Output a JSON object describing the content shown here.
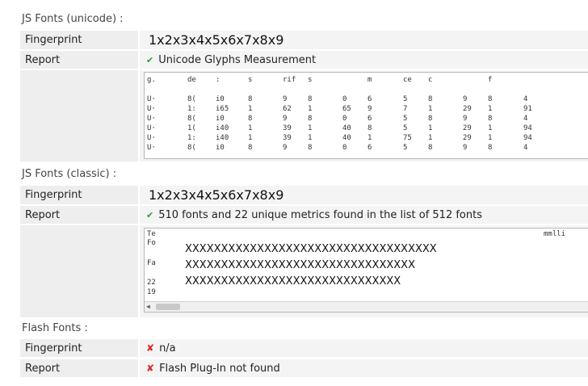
{
  "unicode": {
    "title": "JS Fonts (unicode) :",
    "fingerprint_label": "Fingerprint",
    "fingerprint_value": "1x2x3x4x5x6x7x8x9",
    "report_label": "Report",
    "report_icon": "check-icon",
    "report_value": "Unicode Glyphs Measurement",
    "table_header": [
      "g.",
      "de",
      ":",
      "s",
      "rif",
      "s",
      "",
      "m",
      "ce",
      "c",
      "",
      "f",
      ""
    ],
    "table_rows": [
      [
        "U·",
        "8(",
        "i0",
        "8",
        "9",
        "8",
        "0",
        "6",
        "5",
        "8",
        "9",
        "8",
        "4"
      ],
      [
        "U·",
        "1:",
        "i65",
        "1",
        "62",
        "1",
        "65",
        "9",
        "7",
        "1",
        "29",
        "1",
        "91"
      ],
      [
        "U·",
        "8(",
        "i0",
        "8",
        "9",
        "8",
        "0",
        "6",
        "5",
        "8",
        "9",
        "8",
        "4"
      ],
      [
        "U·",
        "1(",
        "i40",
        "1",
        "39",
        "1",
        "40",
        "8",
        "5",
        "1",
        "29",
        "1",
        "94"
      ],
      [
        "U·",
        "1:",
        "i40",
        "1",
        "39",
        "1",
        "40",
        "1",
        "75",
        "1",
        "29",
        "1",
        "94"
      ],
      [
        "U·",
        "8(",
        "i0",
        "8",
        "9",
        "8",
        "0",
        "6",
        "5",
        "8",
        "9",
        "8",
        "4"
      ]
    ]
  },
  "classic": {
    "title": "JS Fonts (classic) :",
    "fingerprint_label": "Fingerprint",
    "fingerprint_value": "1x2x3x4x5x6x7x8x9",
    "report_label": "Report",
    "report_icon": "check-icon",
    "report_value": "510 fonts and 22 unique metrics found in the list of 512 fonts",
    "list_left": [
      "Te",
      "Fo",
      "",
      "Fa",
      "",
      "22",
      "19"
    ],
    "list_right_header": "mmlli",
    "sample_lines": [
      "XXXXXXXXXXXXXXXXXXXXXXXXXXXXXXXXXXX",
      "XXXXXXXXXXXXXXXXXXXXXXXXXXXXXXXX",
      "XXXXXXXXXXXXXXXXXXXXXXXXXXXXXX"
    ]
  },
  "flash": {
    "title": "Flash Fonts :",
    "fingerprint_label": "Fingerprint",
    "fingerprint_icon": "cross-icon",
    "fingerprint_value": "n/a",
    "report_label": "Report",
    "report_icon": "cross-icon",
    "report_value": "Flash Plug-In not found"
  },
  "colors": {
    "ok": "#2a9d2a",
    "bad": "#dd2222",
    "label_bg": "#eeeeee",
    "value_bg": "#f4f4f4"
  }
}
